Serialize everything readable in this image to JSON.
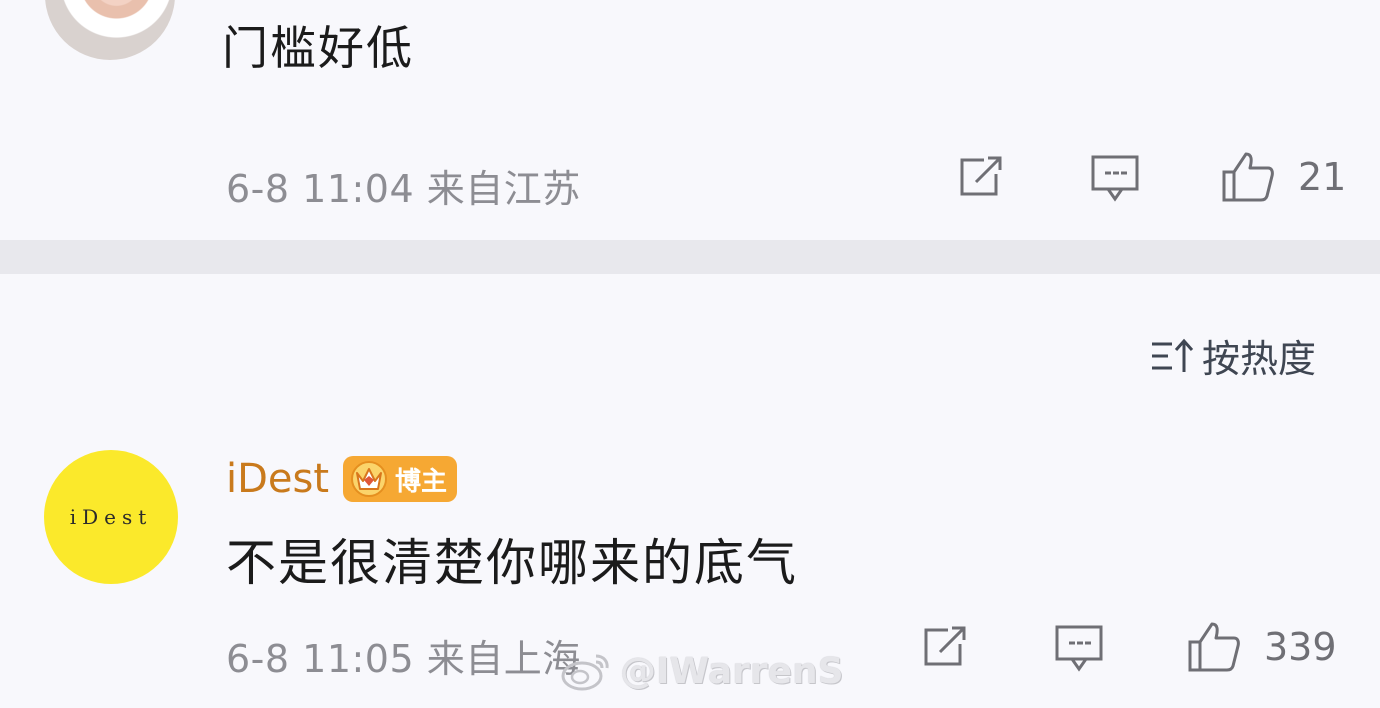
{
  "top_comment": {
    "text": "门槛好低",
    "meta": "6-8 11:04 来自江苏",
    "like_count": "21"
  },
  "sort": {
    "label": "按热度"
  },
  "reply": {
    "username": "iDest",
    "avatar_text": "iDest",
    "badge_label": "博主",
    "text": "不是很清楚你哪来的底气",
    "meta": "6-8 11:05 来自上海",
    "like_count": "339"
  },
  "watermark": {
    "text": "@IWarrenS"
  },
  "icons": {
    "share": "share-icon",
    "comment": "comment-icon",
    "like": "thumbs-up-icon",
    "sort": "sort-icon"
  },
  "colors": {
    "background": "#f8f8fc",
    "divider": "#e8e8ed",
    "meta": "#8d8d93",
    "username": "#c97a1c",
    "badge": "#f6a833",
    "avatar_idest": "#fbe92b"
  }
}
